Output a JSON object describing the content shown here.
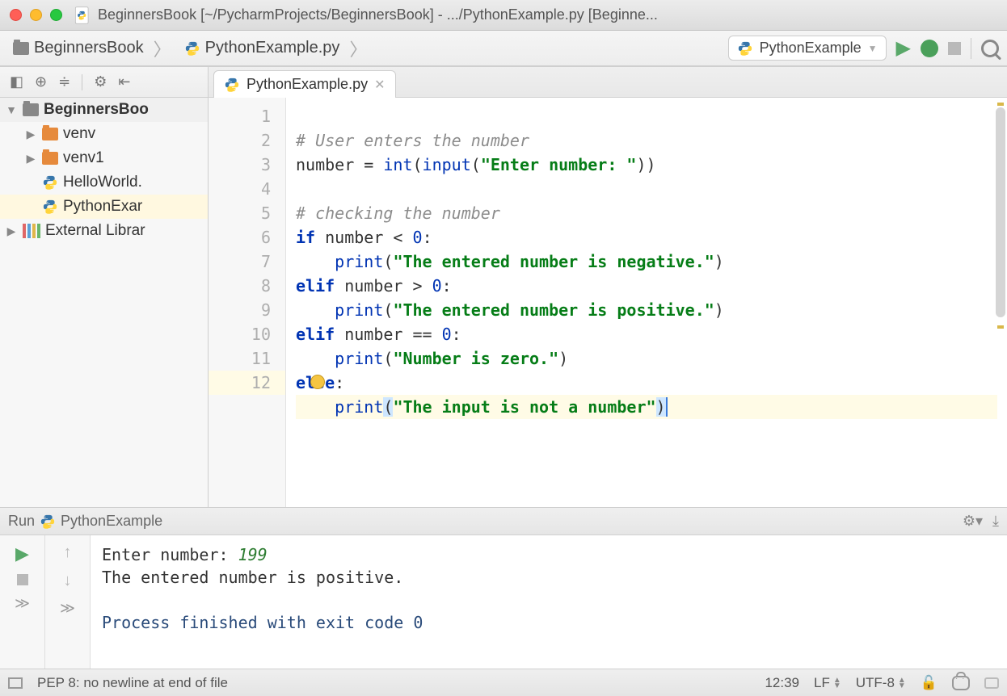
{
  "window": {
    "title": "BeginnersBook [~/PycharmProjects/BeginnersBook] - .../PythonExample.py [Beginne..."
  },
  "breadcrumb": {
    "project": "BeginnersBook",
    "file": "PythonExample.py"
  },
  "toolbar": {
    "run_config": "PythonExample"
  },
  "tree": {
    "root": "BeginnersBoo",
    "items": [
      {
        "label": "venv",
        "kind": "folder"
      },
      {
        "label": "venv1",
        "kind": "folder"
      },
      {
        "label": "HelloWorld.",
        "kind": "py"
      },
      {
        "label": "PythonExar",
        "kind": "py"
      }
    ],
    "external": "External Librar"
  },
  "tab": {
    "label": "PythonExample.py"
  },
  "editor": {
    "gutter": [
      "1",
      "2",
      "3",
      "4",
      "5",
      "6",
      "7",
      "8",
      "9",
      "10",
      "11",
      "12"
    ],
    "lines": {
      "l1": "# User enters the number",
      "l2a": "number = ",
      "l2b": "int",
      "l2c": "(",
      "l2d": "input",
      "l2e": "(",
      "l2f": "\"Enter number: \"",
      "l2g": "))",
      "l4": "# checking the number",
      "l5a": "if",
      "l5b": " number < ",
      "l5c": "0",
      "l5d": ":",
      "l6a": "    ",
      "l6b": "print",
      "l6c": "(",
      "l6d": "\"The entered number is negative.\"",
      "l6e": ")",
      "l7a": "elif",
      "l7b": " number > ",
      "l7c": "0",
      "l7d": ":",
      "l8a": "    ",
      "l8b": "print",
      "l8c": "(",
      "l8d": "\"The entered number is positive.\"",
      "l8e": ")",
      "l9a": "elif",
      "l9b": " number == ",
      "l9c": "0",
      "l9d": ":",
      "l10a": "    ",
      "l10b": "print",
      "l10c": "(",
      "l10d": "\"Number is zero.\"",
      "l10e": ")",
      "l11a": "else",
      "l11b": ":",
      "l12a": "    ",
      "l12b": "print",
      "l12c": "(",
      "l12d": "\"The input is not a number\"",
      "l12e": ")"
    }
  },
  "run": {
    "tab_prefix": "Run",
    "tab_label": "PythonExample",
    "console": {
      "prompt": "Enter number: ",
      "input": "199",
      "out1": "The entered number is positive.",
      "out2": "Process finished with exit code 0"
    }
  },
  "status": {
    "msg": "PEP 8: no newline at end of file",
    "pos": "12:39",
    "eol": "LF",
    "enc": "UTF-8"
  }
}
